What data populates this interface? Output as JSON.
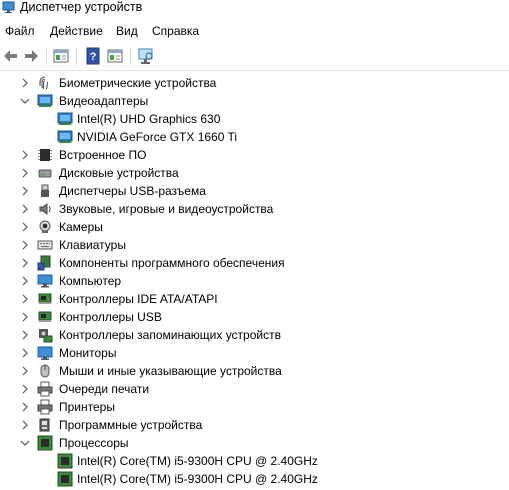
{
  "window": {
    "title": "Диспетчер устройств"
  },
  "menu": [
    "Файл",
    "Действие",
    "Вид",
    "Справка"
  ],
  "toolbar": {
    "buttons": [
      {
        "name": "back-arrow-icon"
      },
      {
        "name": "forward-arrow-icon"
      },
      {
        "name": "properties-icon"
      },
      {
        "name": "help-icon"
      },
      {
        "name": "update-driver-icon"
      },
      {
        "name": "scan-hardware-icon"
      }
    ]
  },
  "tree": {
    "items": [
      {
        "label": "Биометрические устройства",
        "level": 0,
        "expanded": false,
        "icon": "fingerprint-icon"
      },
      {
        "label": "Видеоадаптеры",
        "level": 0,
        "expanded": true,
        "icon": "display-adapter-icon"
      },
      {
        "label": "Intel(R) UHD Graphics 630",
        "level": 1,
        "icon": "display-adapter-icon"
      },
      {
        "label": "NVIDIA GeForce GTX 1660 Ti",
        "level": 1,
        "icon": "display-adapter-icon"
      },
      {
        "label": "Встроенное ПО",
        "level": 0,
        "expanded": false,
        "icon": "firmware-icon"
      },
      {
        "label": "Дисковые устройства",
        "level": 0,
        "expanded": false,
        "icon": "disk-drive-icon"
      },
      {
        "label": "Диспетчеры USB-разъема",
        "level": 0,
        "expanded": false,
        "icon": "usb-connector-icon"
      },
      {
        "label": "Звуковые, игровые и видеоустройства",
        "level": 0,
        "expanded": false,
        "icon": "speaker-icon"
      },
      {
        "label": "Камеры",
        "level": 0,
        "expanded": false,
        "icon": "camera-icon"
      },
      {
        "label": "Клавиатуры",
        "level": 0,
        "expanded": false,
        "icon": "keyboard-icon"
      },
      {
        "label": "Компоненты программного обеспечения",
        "level": 0,
        "expanded": false,
        "icon": "software-component-icon"
      },
      {
        "label": "Компьютер",
        "level": 0,
        "expanded": false,
        "icon": "computer-icon"
      },
      {
        "label": "Контроллеры IDE ATA/ATAPI",
        "level": 0,
        "expanded": false,
        "icon": "ide-controller-icon"
      },
      {
        "label": "Контроллеры USB",
        "level": 0,
        "expanded": false,
        "icon": "usb-controller-icon"
      },
      {
        "label": "Контроллеры запоминающих устройств",
        "level": 0,
        "expanded": false,
        "icon": "storage-controller-icon"
      },
      {
        "label": "Мониторы",
        "level": 0,
        "expanded": false,
        "icon": "monitor-icon"
      },
      {
        "label": "Мыши и иные указывающие устройства",
        "level": 0,
        "expanded": false,
        "icon": "mouse-icon"
      },
      {
        "label": "Очереди печати",
        "level": 0,
        "expanded": false,
        "icon": "print-queue-icon"
      },
      {
        "label": "Принтеры",
        "level": 0,
        "expanded": false,
        "icon": "printer-icon"
      },
      {
        "label": "Программные устройства",
        "level": 0,
        "expanded": false,
        "icon": "software-device-icon"
      },
      {
        "label": "Процессоры",
        "level": 0,
        "expanded": true,
        "icon": "processor-icon"
      },
      {
        "label": "Intel(R) Core(TM) i5-9300H CPU @ 2.40GHz",
        "level": 1,
        "icon": "processor-icon"
      },
      {
        "label": "Intel(R) Core(TM) i5-9300H CPU @ 2.40GHz",
        "level": 1,
        "icon": "processor-icon"
      }
    ]
  }
}
